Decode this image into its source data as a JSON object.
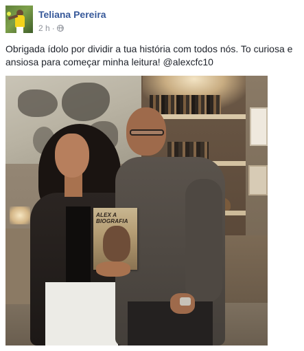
{
  "post": {
    "author_name": "Teliana Pereira",
    "timestamp": "2 h",
    "separator": "·",
    "text": "Obrigada ídolo por dividir a tua história com todos nós. To curiosa e ansiosa para começar minha leitura! @alexcfc10"
  },
  "photo": {
    "book_cover_text": "ALEX A BIOGRAFIA"
  },
  "icons": {
    "avatar": "profile-photo",
    "privacy": "globe-icon"
  },
  "colors": {
    "author_link": "#365899",
    "meta_text": "#90949c",
    "body_text": "#1d2129"
  }
}
